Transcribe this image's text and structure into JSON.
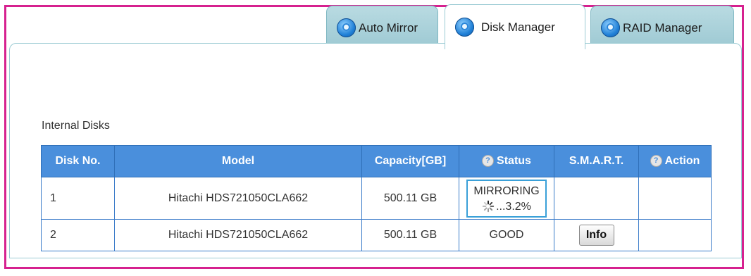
{
  "tabs": [
    {
      "label": "Auto Mirror",
      "icon": "disk-icon"
    },
    {
      "label": "Disk Manager",
      "icon": "disk-icon",
      "active": true
    },
    {
      "label": "RAID Manager",
      "icon": "disk-icon"
    }
  ],
  "section_title": "Internal Disks",
  "table": {
    "headers": [
      "Disk No.",
      "Model",
      "Capacity[GB]",
      "Status",
      "S.M.A.R.T.",
      "Action"
    ],
    "help_icon": "?",
    "rows": [
      {
        "no": "1",
        "model": "Hitachi HDS721050CLA662",
        "capacity": "500.11 GB",
        "status": "MIRRORING",
        "progress": "...3.2%",
        "smart": "",
        "action": ""
      },
      {
        "no": "2",
        "model": "Hitachi HDS721050CLA662",
        "capacity": "500.11 GB",
        "status": "GOOD",
        "smart": "Info",
        "action": ""
      }
    ]
  },
  "colors": {
    "frame": "#d6218f",
    "header_bg": "#4a8fdc",
    "tab_inactive": "#a9d1da",
    "status_border": "#3aa0d8"
  }
}
